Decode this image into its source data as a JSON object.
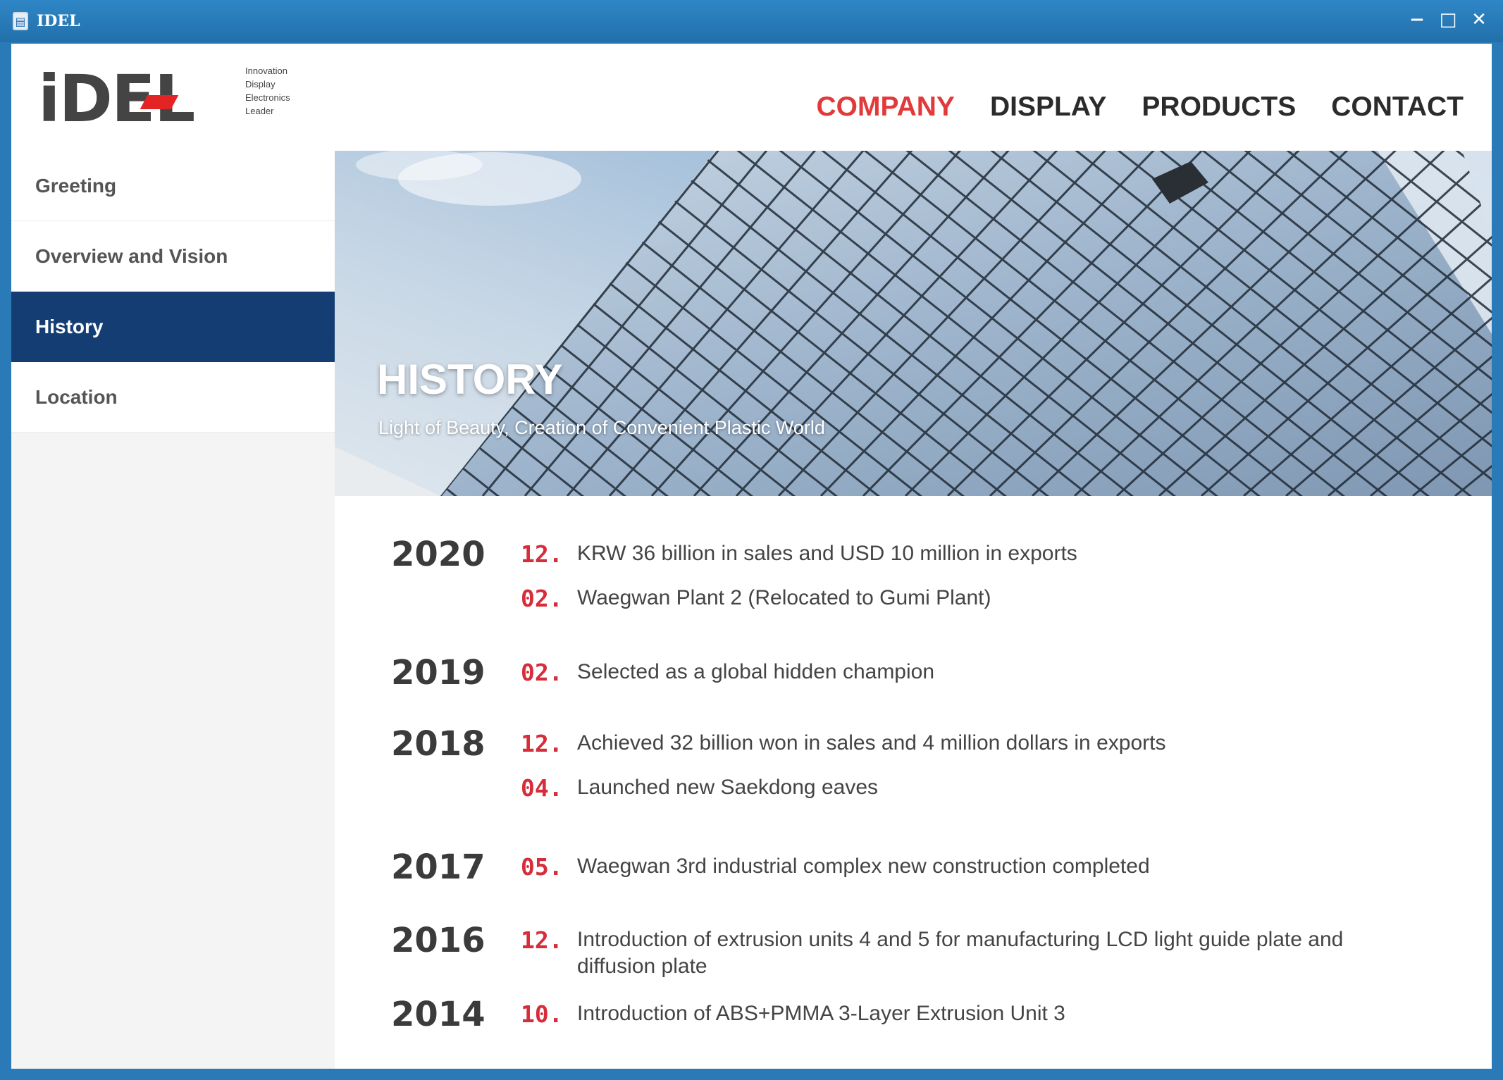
{
  "window": {
    "title": "IDEL",
    "icon": "app-icon",
    "controls": [
      "minimize-icon",
      "maximize-icon",
      "close-icon"
    ]
  },
  "logo": {
    "mark": "iDEL",
    "tagline": [
      "Innovation",
      "Display",
      "Electronics",
      "Leader"
    ]
  },
  "nav": [
    {
      "label": "COMPANY",
      "active": true
    },
    {
      "label": "DISPLAY",
      "active": false
    },
    {
      "label": "PRODUCTS",
      "active": false
    },
    {
      "label": "CONTACT",
      "active": false
    }
  ],
  "sidebar": {
    "items": [
      {
        "label": "Greeting",
        "active": false
      },
      {
        "label": "Overview and Vision",
        "active": false
      },
      {
        "label": "History",
        "active": true
      },
      {
        "label": "Location",
        "active": false
      }
    ]
  },
  "hero": {
    "title": "HISTORY",
    "subtitle": "Light of Beauty, Creation of Convenient Plastic World"
  },
  "history": [
    {
      "year": "2020",
      "events": [
        {
          "month": "12.",
          "text": "KRW 36 billion in sales and USD 10 million in exports"
        },
        {
          "month": "02.",
          "text": "Waegwan Plant 2 (Relocated to Gumi Plant)"
        }
      ]
    },
    {
      "year": "2019",
      "events": [
        {
          "month": "02.",
          "text": "Selected as a global hidden champion"
        }
      ]
    },
    {
      "year": "2018",
      "events": [
        {
          "month": "12.",
          "text": "Achieved 32 billion won in sales and 4 million dollars in exports"
        },
        {
          "month": "04.",
          "text": "Launched new Saekdong eaves"
        }
      ]
    },
    {
      "year": "2017",
      "events": [
        {
          "month": "05.",
          "text": "Waegwan 3rd industrial complex new construction completed"
        }
      ]
    },
    {
      "year": "2016",
      "events": [
        {
          "month": "12.",
          "text": "Introduction of extrusion units 4 and 5 for manufacturing LCD light guide plate and diffusion plate"
        }
      ]
    },
    {
      "year": "2014",
      "events": [
        {
          "month": "10.",
          "text": "Introduction of ABS+PMMA 3-Layer Extrusion Unit 3"
        }
      ]
    }
  ],
  "colors": {
    "titlebar": "#2a7ab8",
    "accent": "#e23a3a",
    "sidebar_active": "#143d73",
    "month": "#d62d3a"
  }
}
